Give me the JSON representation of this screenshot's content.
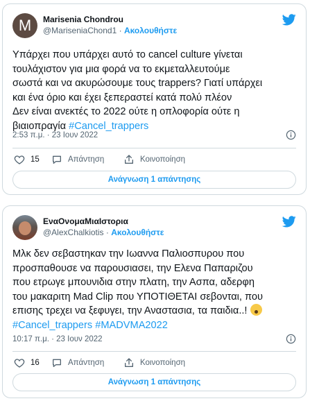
{
  "tweets": [
    {
      "display_name": "Marisenia Chondrou",
      "handle": "@MariseniaChond1",
      "follow_label": "Ακολουθήστε",
      "avatar_letter": "M",
      "text_lines": [
        "Υπάρχει που υπάρχει αυτό το cancel culture γίνεται",
        "τουλάχιστον για μια φορά να το εκμεταλλευτούμε",
        "σωστά και να ακυρώσουμε τους trappers? Γιατί υπάρχει",
        "και ένα όριο και έχει ξεπεραστεί κατά πολύ πλέον",
        "Δεν είναι ανεκτές το 2022 ούτε η οπλοφορία ούτε η",
        "βιαιοπραγία "
      ],
      "hashtags": [
        "#Cancel_trappers"
      ],
      "timestamp": "2:53 π.μ. · 23 Ιουν 2022",
      "like_count": "15",
      "reply_label": "Απάντηση",
      "share_label": "Κοινοποίηση",
      "read_replies_label": "Ανάγνωση 1 απάντησης"
    },
    {
      "display_name": "ΕναΟνομαΜιαΙστορια",
      "handle": "@AlexChalkiotis",
      "follow_label": "Ακολουθήστε",
      "text_lines": [
        "Μλκ δεν σεβαστηκαν την Ιωαννα Παλιοσπυρου που",
        "προσπαθουσε να παρουσιασει, την Ελενα Παπαριζου",
        "που ετρωγε μπουνιδια στην πλατη, την Ασπα, αδερφη",
        "του μακαριτη Mad Clip που ΥΠΟΤΙΘΕΤΑΙ σεβονται, που",
        "επισης τρεχει να ξεφυγει, την Αναστασια, τα παιδια..! "
      ],
      "hashtags": [
        "#Cancel_trappers",
        "#MADVMA2022"
      ],
      "emoji": "fearful-face",
      "timestamp": "10:17 π.μ. · 23 Ιουν 2022",
      "like_count": "16",
      "reply_label": "Απάντηση",
      "share_label": "Κοινοποίηση",
      "read_replies_label": "Ανάγνωση 1 απάντησης"
    }
  ],
  "icons": [
    "twitter-bird-icon",
    "info-icon",
    "heart-icon",
    "reply-bubble-icon",
    "share-upload-icon"
  ],
  "colors": {
    "accent": "#1d9bf0",
    "text": "#0f1419",
    "muted": "#536471",
    "border": "#cfd9de"
  }
}
